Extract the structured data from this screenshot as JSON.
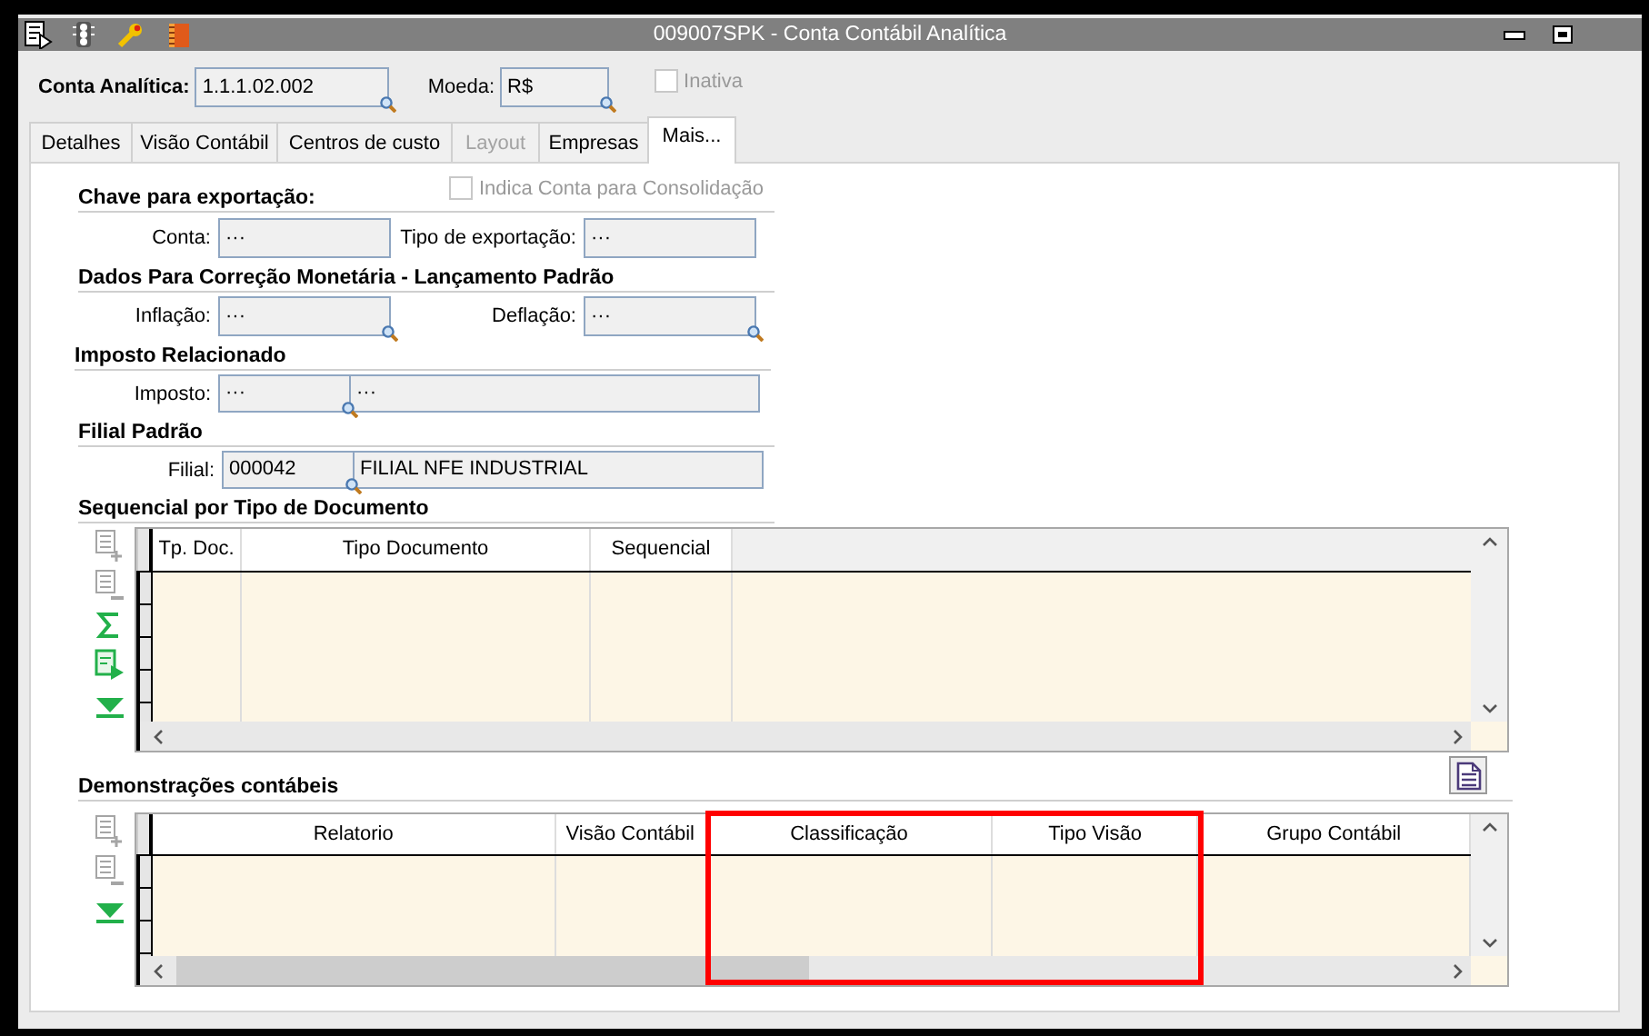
{
  "window": {
    "title": "009007SPK - Conta Contábil Analítica"
  },
  "header": {
    "account": {
      "label": "Conta Analítica:",
      "value": "1.1.1.02.002",
      "lookup": true
    },
    "currency": {
      "label": "Moeda:",
      "value": "R$",
      "lookup": true
    },
    "inactive": {
      "label": "Inativa",
      "checked": false,
      "disabled": true
    }
  },
  "tabs": [
    {
      "label": "Detalhes",
      "selected": false,
      "disabled": false
    },
    {
      "label": "Visão Contábil",
      "selected": false,
      "disabled": false
    },
    {
      "label": "Centros de custo",
      "selected": false,
      "disabled": false
    },
    {
      "label": "Layout",
      "selected": false,
      "disabled": true
    },
    {
      "label": "Empresas",
      "selected": false,
      "disabled": false
    },
    {
      "label": "Mais...",
      "selected": true,
      "disabled": false
    }
  ],
  "export_key": {
    "title": "Chave para exportação:",
    "consolidation": {
      "label": "Indica Conta para Consolidação",
      "checked": false,
      "disabled": true
    },
    "fields": [
      {
        "label": "Conta:",
        "values": [
          "···"
        ],
        "lookup": false
      },
      {
        "label": "Tipo de exportação:",
        "values": [
          "···"
        ],
        "lookup": false
      }
    ]
  },
  "monetary_correction": {
    "title": "Dados Para Correção Monetária - Lançamento Padrão",
    "fields": [
      {
        "label": "Inflação:",
        "values": [
          "···"
        ],
        "lookup": true
      },
      {
        "label": "Deflação:",
        "values": [
          "···"
        ],
        "lookup": true
      }
    ]
  },
  "related_tax": {
    "title": "Imposto Relacionado",
    "fields": [
      {
        "label": "Imposto:",
        "values": [
          "···",
          "···"
        ],
        "lookup": true
      }
    ]
  },
  "default_branch": {
    "title": "Filial Padrão",
    "fields": [
      {
        "label": "Filial:",
        "values": [
          "000042",
          "FILIAL NFE INDUSTRIAL"
        ],
        "lookup": true
      }
    ]
  },
  "document_sequence": {
    "title": "Sequencial por Tipo de Documento",
    "tools": [
      {
        "kind": "add",
        "disabled": true
      },
      {
        "kind": "remove",
        "disabled": true
      },
      {
        "kind": "sum",
        "disabled": false
      },
      {
        "kind": "export",
        "disabled": false
      },
      {
        "kind": "expand",
        "disabled": false
      }
    ],
    "columns": [
      {
        "label": "Tp. Doc."
      },
      {
        "label": "Tipo Documento"
      },
      {
        "label": "Sequencial"
      }
    ]
  },
  "statements": {
    "title": "Demonstrações contábeis",
    "tools": [
      {
        "kind": "add",
        "disabled": true
      },
      {
        "kind": "remove",
        "disabled": true
      },
      {
        "kind": "expand",
        "disabled": false
      }
    ],
    "columns": [
      {
        "label": "Relatorio",
        "highlighted": false
      },
      {
        "label": "Visão Contábil",
        "highlighted": false
      },
      {
        "label": "Classificação",
        "highlighted": true
      },
      {
        "label": "Tipo Visão",
        "highlighted": true
      },
      {
        "label": "Grupo Contábil",
        "highlighted": false
      }
    ]
  }
}
